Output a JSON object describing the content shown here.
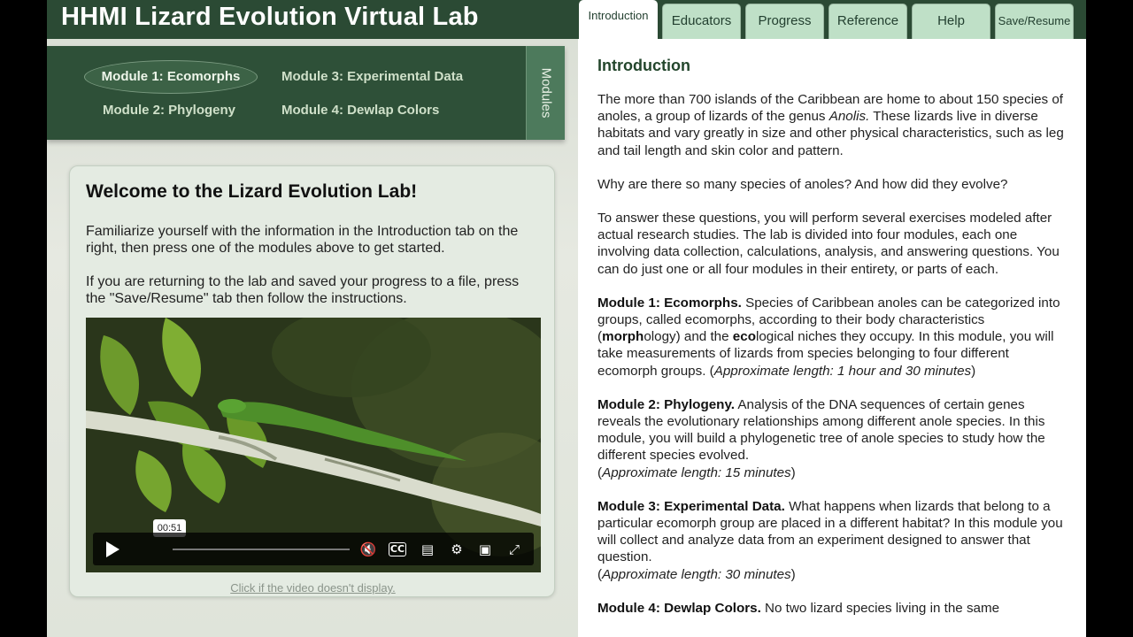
{
  "app": {
    "title": "HHMI Lizard Evolution Virtual Lab"
  },
  "modules": {
    "side_tab_label": "Modules",
    "items": [
      {
        "label": "Module 1: Ecomorphs"
      },
      {
        "label": "Module 2: Phylogeny"
      },
      {
        "label": "Module 3: Experimental Data"
      },
      {
        "label": "Module 4: Dewlap Colors"
      }
    ]
  },
  "welcome": {
    "title": "Welcome to the Lizard Evolution Lab!",
    "p1": "Familiarize yourself with the information in the Introduction tab on the right, then press one of the modules above to get started.",
    "p2": "If you are returning to the lab and saved your progress to a file, press the \"Save/Resume\" tab then follow the instructions.",
    "video_link": "Click if the video doesn't display."
  },
  "video": {
    "time_tooltip": "00:51",
    "controls": {
      "play": "play-icon",
      "mute": "muted-icon",
      "cc": "CC",
      "transcript": "transcript-icon",
      "settings": "gear-icon",
      "pip": "picture-in-picture-icon",
      "fullscreen": "fullscreen-icon"
    }
  },
  "tabs": [
    {
      "label": "Introduction",
      "active": true
    },
    {
      "label": "Educators"
    },
    {
      "label": "Progress"
    },
    {
      "label": "Reference"
    },
    {
      "label": "Help"
    },
    {
      "label": "Save/Resume"
    }
  ],
  "intro": {
    "title": "Introduction",
    "p1_a": "The more than 700 islands of the Caribbean are home to about 150 species of anoles, a group of lizards of the genus ",
    "p1_italic": "Anolis.",
    "p1_b": " These lizards live in diverse habitats and vary greatly in size and other physical characteristics, such as leg and tail length and skin color and pattern.",
    "p2": "Why are there so many species of anoles? And how did they evolve?",
    "p3": "To answer these questions, you will perform several exercises modeled after actual research studies. The lab is divided into four modules, each one involving data collection, calculations, analysis, and answering questions. You can do just one or all four modules in their entirety, or parts of each.",
    "m1_head": "Module 1: Ecomorphs.",
    "m1_text_a": " Species of Caribbean anoles can be categorized into groups, called ecomorphs, according to their body characteristics (",
    "m1_bold_morph": "morph",
    "m1_text_b": "ology) and the ",
    "m1_bold_eco": "eco",
    "m1_text_c": "logical niches they occupy. In this module, you will take measurements of lizards from species belonging to four different ecomorph groups. (",
    "m1_len": "Approximate length: 1 hour and 30 minutes",
    "m2_head": "Module 2: Phylogeny.",
    "m2_text": " Analysis of the DNA sequences of certain genes reveals the evolutionary relationships among different anole species. In this module, you will build a phylogenetic tree of anole species to study how the different species evolved.",
    "m2_len": "Approximate length: 15 minutes",
    "m3_head": "Module 3: Experimental Data.",
    "m3_text": " What happens when lizards that belong to a particular ecomorph group are placed in a different habitat? In this module you will collect and analyze data from an experiment designed to answer that question.",
    "m3_len": "Approximate length: 30 minutes",
    "m4_head": "Module 4: Dewlap Colors.",
    "m4_text": " No two lizard species living in the same"
  }
}
